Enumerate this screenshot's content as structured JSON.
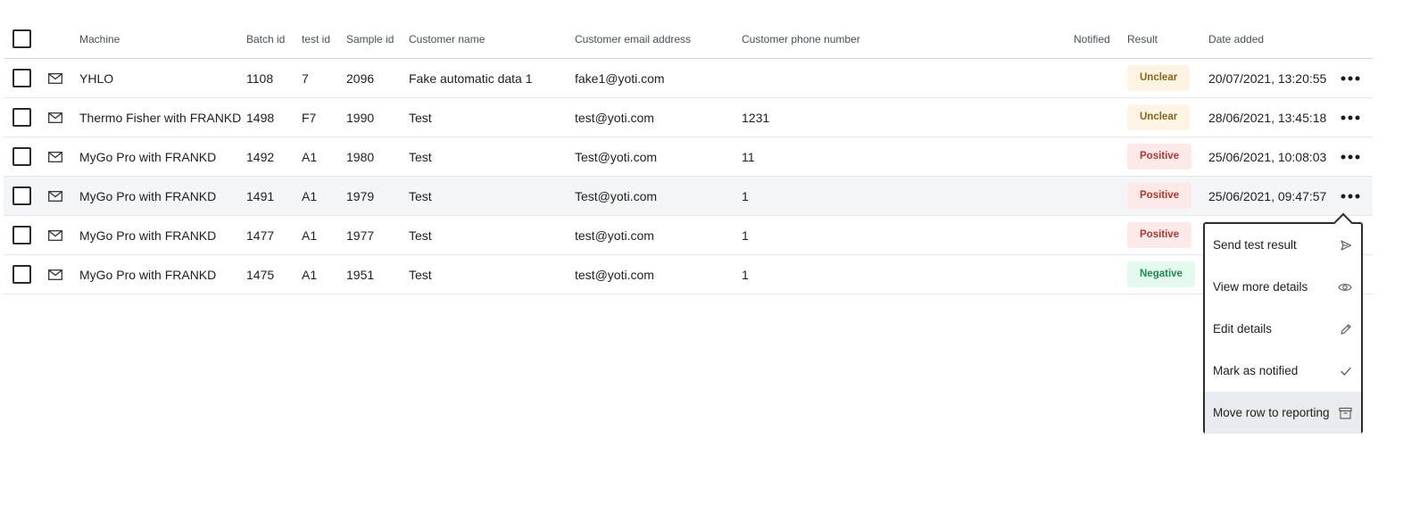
{
  "columns": {
    "machine": "Machine",
    "batch_id": "Batch id",
    "test_id": "test id",
    "sample_id": "Sample id",
    "customer_name": "Customer name",
    "customer_email": "Customer email address",
    "customer_phone": "Customer phone number",
    "notified": "Notified",
    "result": "Result",
    "date_added": "Date added"
  },
  "rows": [
    {
      "machine": "YHLO",
      "batch_id": "1108",
      "test_id": "7",
      "sample_id": "2096",
      "customer_name": "Fake automatic data 1",
      "email": "fake1@yoti.com",
      "phone": "",
      "result": "Unclear",
      "date": "20/07/2021, 13:20:55"
    },
    {
      "machine": "Thermo Fisher with FRANKD",
      "batch_id": "1498",
      "test_id": "F7",
      "sample_id": "1990",
      "customer_name": "Test",
      "email": "test@yoti.com",
      "phone": "1231",
      "result": "Unclear",
      "date": "28/06/2021, 13:45:18"
    },
    {
      "machine": "MyGo Pro with FRANKD",
      "batch_id": "1492",
      "test_id": "A1",
      "sample_id": "1980",
      "customer_name": "Test",
      "email": "Test@yoti.com",
      "phone": "11",
      "result": "Positive",
      "date": "25/06/2021, 10:08:03"
    },
    {
      "machine": "MyGo Pro with FRANKD",
      "batch_id": "1491",
      "test_id": "A1",
      "sample_id": "1979",
      "customer_name": "Test",
      "email": "Test@yoti.com",
      "phone": "1",
      "result": "Positive",
      "date": "25/06/2021, 09:47:57"
    },
    {
      "machine": "MyGo Pro with FRANKD",
      "batch_id": "1477",
      "test_id": "A1",
      "sample_id": "1977",
      "customer_name": "Test",
      "email": "test@yoti.com",
      "phone": "1",
      "result": "Positive",
      "date": ""
    },
    {
      "machine": "MyGo Pro with FRANKD",
      "batch_id": "1475",
      "test_id": "A1",
      "sample_id": "1951",
      "customer_name": "Test",
      "email": "test@yoti.com",
      "phone": "1",
      "result": "Negative",
      "date": ""
    }
  ],
  "menu": {
    "items": [
      {
        "label": "Send test result",
        "icon": "send-icon"
      },
      {
        "label": "View more details",
        "icon": "eye-icon"
      },
      {
        "label": "Edit details",
        "icon": "pencil-icon"
      },
      {
        "label": "Mark as notified",
        "icon": "check-icon"
      },
      {
        "label": "Move row to reporting",
        "icon": "archive-icon"
      }
    ]
  },
  "colors": {
    "unclear_bg": "#fdf4e3",
    "unclear_text": "#8a6418",
    "positive_bg": "#fde9e8",
    "positive_text": "#b3372f",
    "negative_bg": "#e4faee",
    "negative_text": "#1e8b4f"
  }
}
